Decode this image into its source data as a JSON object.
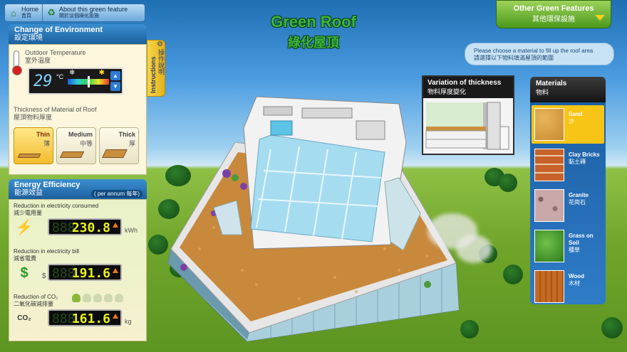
{
  "nav": {
    "home_en": "Home",
    "home_zh": "首頁",
    "about_en": "About this green feature",
    "about_zh": "關於這個綠化設施"
  },
  "title": {
    "en": "Green Roof",
    "zh": "綠化屋頂"
  },
  "other_features": {
    "en": "Other Green Features",
    "zh": "其他環保設施"
  },
  "hint": {
    "en": "Please choose a material to fill up the roof area",
    "zh": "請選擇以下物料填滿屋頂的範圍"
  },
  "environment": {
    "title_en": "Change of Environment",
    "title_zh": "設定環境",
    "temp_label_en": "Outdoor Temperature",
    "temp_label_zh": "室外溫度",
    "temperature": "29",
    "temp_unit": "°C",
    "thickness_label_en": "Thickness of Material of Roof",
    "thickness_label_zh": "屋頂物料厚度",
    "thickness_options": [
      {
        "en": "Thin",
        "zh": "薄",
        "active": true
      },
      {
        "en": "Medium",
        "zh": "中等",
        "active": false
      },
      {
        "en": "Thick",
        "zh": "厚",
        "active": false
      }
    ]
  },
  "instructions": {
    "en": "Instructions",
    "zh": "操作說明"
  },
  "energy": {
    "title_en": "Energy Efficiency",
    "title_zh": "能源效益",
    "per_annum": "( per annum 每年)",
    "electricity_consumed": {
      "label_en": "Reduction in electricity consumed",
      "label_zh": "減少電用量",
      "value": "230.8",
      "unit": "kWh"
    },
    "electricity_bill": {
      "label_en": "Reduction in electricity bill",
      "label_zh": "減省電費",
      "currency": "$",
      "value": "191.6"
    },
    "co2": {
      "label_en": "Reduction of CO₂",
      "label_zh": "二氧化碳減排量",
      "value": "161.6",
      "unit": "kg",
      "trees_total": 5,
      "trees_on": 1
    }
  },
  "variation": {
    "title_en": "Variation of thickness",
    "title_zh": "物料厚度變化"
  },
  "materials": {
    "title_en": "Materials",
    "title_zh": "物料",
    "items": [
      {
        "en": "Sand",
        "zh": "沙",
        "active": true,
        "color": "#d9a040"
      },
      {
        "en": "Clay Bricks",
        "zh": "黏土磚",
        "active": false,
        "color": "#c8622a"
      },
      {
        "en": "Granite",
        "zh": "花崗石",
        "active": false,
        "color": "#b89a9a"
      },
      {
        "en": "Grass on Soil",
        "zh": "種草",
        "active": false,
        "color": "#5aa83a"
      },
      {
        "en": "Wood",
        "zh": "木材",
        "active": false,
        "color": "#c46a22"
      }
    ]
  }
}
